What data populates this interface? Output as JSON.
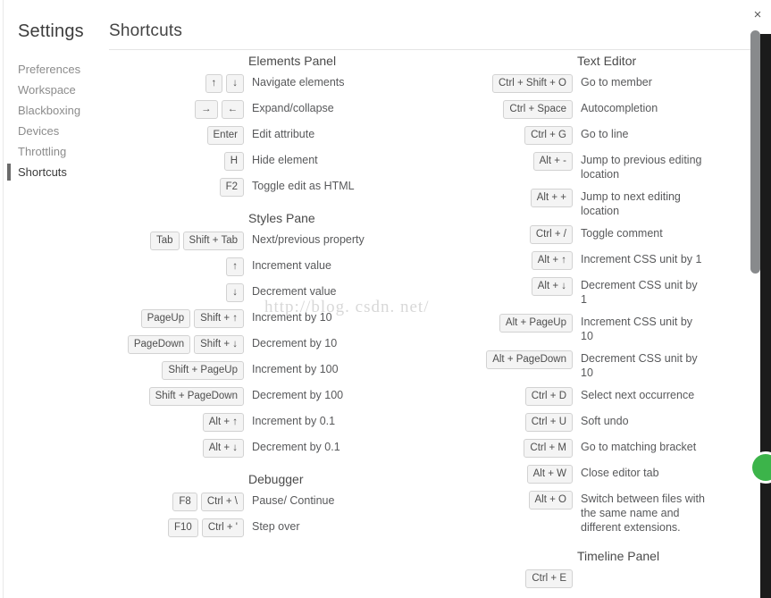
{
  "window": {
    "close_label": "×"
  },
  "header": {
    "settings_title": "Settings",
    "page_title": "Shortcuts"
  },
  "sidebar": {
    "items": [
      {
        "label": "Preferences",
        "active": false
      },
      {
        "label": "Workspace",
        "active": false
      },
      {
        "label": "Blackboxing",
        "active": false
      },
      {
        "label": "Devices",
        "active": false
      },
      {
        "label": "Throttling",
        "active": false
      },
      {
        "label": "Shortcuts",
        "active": true
      }
    ]
  },
  "watermark": {
    "text": "http://blog. csdn. net/"
  },
  "columns": {
    "left": [
      {
        "title": "Elements Panel",
        "rows": [
          {
            "keys": [
              "↑",
              "↓"
            ],
            "desc": "Navigate elements"
          },
          {
            "keys": [
              "→",
              "←"
            ],
            "desc": "Expand/collapse"
          },
          {
            "keys": [
              "Enter"
            ],
            "desc": "Edit attribute"
          },
          {
            "keys": [
              "H"
            ],
            "desc": "Hide element"
          },
          {
            "keys": [
              "F2"
            ],
            "desc": "Toggle edit as HTML"
          }
        ]
      },
      {
        "title": "Styles Pane",
        "rows": [
          {
            "keys": [
              "Tab",
              "Shift + Tab"
            ],
            "desc": "Next/previous property"
          },
          {
            "keys": [
              "↑"
            ],
            "desc": "Increment value"
          },
          {
            "keys": [
              "↓"
            ],
            "desc": "Decrement value"
          },
          {
            "keys": [
              "PageUp",
              "Shift + ↑"
            ],
            "desc": "Increment by 10"
          },
          {
            "keys": [
              "PageDown",
              "Shift + ↓"
            ],
            "desc": "Decrement by 10"
          },
          {
            "keys": [
              "Shift + PageUp"
            ],
            "desc": "Increment by 100"
          },
          {
            "keys": [
              "Shift + PageDown"
            ],
            "desc": "Decrement by 100"
          },
          {
            "keys": [
              "Alt + ↑"
            ],
            "desc": "Increment by 0.1"
          },
          {
            "keys": [
              "Alt + ↓"
            ],
            "desc": "Decrement by 0.1"
          }
        ]
      },
      {
        "title": "Debugger",
        "rows": [
          {
            "keys": [
              "F8",
              "Ctrl + \\"
            ],
            "desc": "Pause/ Continue"
          },
          {
            "keys": [
              "F10",
              "Ctrl + '"
            ],
            "desc": "Step over"
          }
        ]
      }
    ],
    "right": [
      {
        "title": "Text Editor",
        "rows": [
          {
            "keys": [
              "Ctrl + Shift + O"
            ],
            "desc": "Go to member"
          },
          {
            "keys": [
              "Ctrl + Space"
            ],
            "desc": "Autocompletion"
          },
          {
            "keys": [
              "Ctrl + G"
            ],
            "desc": "Go to line"
          },
          {
            "keys": [
              "Alt + -"
            ],
            "desc": "Jump to previous editing location"
          },
          {
            "keys": [
              "Alt + +"
            ],
            "desc": "Jump to next editing location"
          },
          {
            "keys": [
              "Ctrl + /"
            ],
            "desc": "Toggle comment"
          },
          {
            "keys": [
              "Alt + ↑"
            ],
            "desc": "Increment CSS unit by 1"
          },
          {
            "keys": [
              "Alt + ↓"
            ],
            "desc": "Decrement CSS unit by 1"
          },
          {
            "keys": [
              "Alt + PageUp"
            ],
            "desc": "Increment CSS unit by 10"
          },
          {
            "keys": [
              "Alt + PageDown"
            ],
            "desc": "Decrement CSS unit by 10"
          },
          {
            "keys": [
              "Ctrl + D"
            ],
            "desc": "Select next occurrence"
          },
          {
            "keys": [
              "Ctrl + U"
            ],
            "desc": "Soft undo"
          },
          {
            "keys": [
              "Ctrl + M"
            ],
            "desc": "Go to matching bracket"
          },
          {
            "keys": [
              "Alt + W"
            ],
            "desc": "Close editor tab"
          },
          {
            "keys": [
              "Alt + O"
            ],
            "desc": "Switch between files with the same name and different extensions."
          }
        ]
      },
      {
        "title": "Timeline Panel",
        "rows": [
          {
            "keys": [
              "Ctrl + E"
            ],
            "desc": ""
          }
        ]
      }
    ]
  }
}
